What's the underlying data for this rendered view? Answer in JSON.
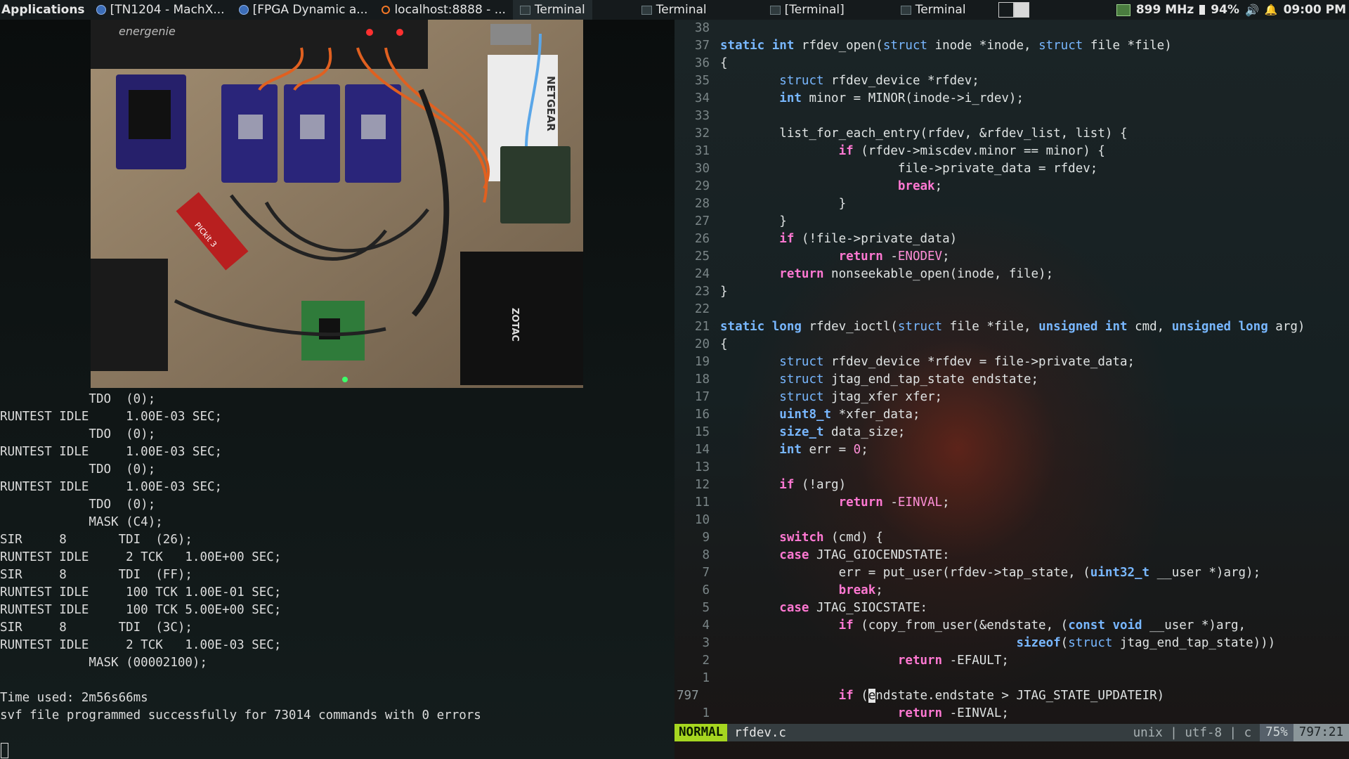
{
  "panel": {
    "applications": "Applications",
    "tasks": [
      {
        "label": "[TN1204 - MachX...",
        "icon": "browser-icon"
      },
      {
        "label": "[FPGA Dynamic a...",
        "icon": "browser-icon"
      },
      {
        "label": "localhost:8888 - ...",
        "icon": "jupyter-icon"
      },
      {
        "label": "Terminal",
        "icon": "terminal-icon"
      },
      {
        "label": "Terminal",
        "icon": "terminal-icon"
      },
      {
        "label": "[Terminal]",
        "icon": "terminal-icon"
      },
      {
        "label": "Terminal",
        "icon": "terminal-icon"
      }
    ],
    "cpu": "899 MHz",
    "battery": "94%",
    "clock": "09:00 PM"
  },
  "left_terminal": {
    "camera_feed_labels": [
      "energenie",
      "NETGEAR",
      "ZOTAC",
      "PICkit 3"
    ],
    "output": "            TDO  (0);\nRUNTEST IDLE     1.00E-03 SEC;\n            TDO  (0);\nRUNTEST IDLE     1.00E-03 SEC;\n            TDO  (0);\nRUNTEST IDLE     1.00E-03 SEC;\n            TDO  (0);\n            MASK (C4);\nSIR     8       TDI  (26);\nRUNTEST IDLE     2 TCK   1.00E+00 SEC;\nSIR     8       TDI  (FF);\nRUNTEST IDLE     100 TCK 1.00E-01 SEC;\nRUNTEST IDLE     100 TCK 5.00E+00 SEC;\nSIR     8       TDI  (3C);\nRUNTEST IDLE     2 TCK   1.00E-03 SEC;\n            MASK (00002100);\n\nTime used: 2m56s66ms\nsvf file programmed successfully for 73014 commands with 0 errors"
  },
  "editor": {
    "lines": [
      {
        "n": "38",
        "t": []
      },
      {
        "n": "37",
        "t": [
          [
            "keyword",
            "static"
          ],
          [
            "plain",
            " "
          ],
          [
            "keyword",
            "int"
          ],
          [
            "plain",
            " rfdev_open("
          ],
          [
            "type",
            "struct"
          ],
          [
            "plain",
            " inode *inode, "
          ],
          [
            "type",
            "struct"
          ],
          [
            "plain",
            " file *file)"
          ]
        ]
      },
      {
        "n": "36",
        "t": [
          [
            "plain",
            "{"
          ]
        ]
      },
      {
        "n": "35",
        "t": [
          [
            "plain",
            "        "
          ],
          [
            "type",
            "struct"
          ],
          [
            "plain",
            " rfdev_device *rfdev;"
          ]
        ]
      },
      {
        "n": "34",
        "t": [
          [
            "plain",
            "        "
          ],
          [
            "keyword",
            "int"
          ],
          [
            "plain",
            " minor = MINOR(inode->i_rdev);"
          ]
        ]
      },
      {
        "n": "33",
        "t": []
      },
      {
        "n": "32",
        "t": [
          [
            "plain",
            "        list_for_each_entry(rfdev, &rfdev_list, list) {"
          ]
        ]
      },
      {
        "n": "31",
        "t": [
          [
            "plain",
            "                "
          ],
          [
            "ctrl",
            "if"
          ],
          [
            "plain",
            " (rfdev->miscdev.minor == minor) {"
          ]
        ]
      },
      {
        "n": "30",
        "t": [
          [
            "plain",
            "                        file->private_data = rfdev;"
          ]
        ]
      },
      {
        "n": "29",
        "t": [
          [
            "plain",
            "                        "
          ],
          [
            "ctrl",
            "break"
          ],
          [
            "plain",
            ";"
          ]
        ]
      },
      {
        "n": "28",
        "t": [
          [
            "plain",
            "                }"
          ]
        ]
      },
      {
        "n": "27",
        "t": [
          [
            "plain",
            "        }"
          ]
        ]
      },
      {
        "n": "26",
        "t": [
          [
            "plain",
            "        "
          ],
          [
            "ctrl",
            "if"
          ],
          [
            "plain",
            " (!file->private_data)"
          ]
        ]
      },
      {
        "n": "25",
        "t": [
          [
            "plain",
            "                "
          ],
          [
            "ctrl",
            "return"
          ],
          [
            "plain",
            " -"
          ],
          [
            "const",
            "ENODEV"
          ],
          [
            "plain",
            ";"
          ]
        ]
      },
      {
        "n": "24",
        "t": [
          [
            "plain",
            "        "
          ],
          [
            "ctrl",
            "return"
          ],
          [
            "plain",
            " nonseekable_open(inode, file);"
          ]
        ]
      },
      {
        "n": "23",
        "t": [
          [
            "plain",
            "}"
          ]
        ]
      },
      {
        "n": "22",
        "t": []
      },
      {
        "n": "21",
        "t": [
          [
            "keyword",
            "static"
          ],
          [
            "plain",
            " "
          ],
          [
            "keyword",
            "long"
          ],
          [
            "plain",
            " rfdev_ioctl("
          ],
          [
            "type",
            "struct"
          ],
          [
            "plain",
            " file *file, "
          ],
          [
            "keyword",
            "unsigned"
          ],
          [
            "plain",
            " "
          ],
          [
            "keyword",
            "int"
          ],
          [
            "plain",
            " cmd, "
          ],
          [
            "keyword",
            "unsigned"
          ],
          [
            "plain",
            " "
          ],
          [
            "keyword",
            "long"
          ],
          [
            "plain",
            " arg)"
          ]
        ]
      },
      {
        "n": "20",
        "t": [
          [
            "plain",
            "{"
          ]
        ]
      },
      {
        "n": "19",
        "t": [
          [
            "plain",
            "        "
          ],
          [
            "type",
            "struct"
          ],
          [
            "plain",
            " rfdev_device *rfdev = file->private_data;"
          ]
        ]
      },
      {
        "n": "18",
        "t": [
          [
            "plain",
            "        "
          ],
          [
            "type",
            "struct"
          ],
          [
            "plain",
            " jtag_end_tap_state endstate;"
          ]
        ]
      },
      {
        "n": "17",
        "t": [
          [
            "plain",
            "        "
          ],
          [
            "type",
            "struct"
          ],
          [
            "plain",
            " jtag_xfer xfer;"
          ]
        ]
      },
      {
        "n": "16",
        "t": [
          [
            "plain",
            "        "
          ],
          [
            "keyword",
            "uint8_t"
          ],
          [
            "plain",
            " *xfer_data;"
          ]
        ]
      },
      {
        "n": "15",
        "t": [
          [
            "plain",
            "        "
          ],
          [
            "keyword",
            "size_t"
          ],
          [
            "plain",
            " data_size;"
          ]
        ]
      },
      {
        "n": "14",
        "t": [
          [
            "plain",
            "        "
          ],
          [
            "keyword",
            "int"
          ],
          [
            "plain",
            " err = "
          ],
          [
            "num",
            "0"
          ],
          [
            "plain",
            ";"
          ]
        ]
      },
      {
        "n": "13",
        "t": []
      },
      {
        "n": "12",
        "t": [
          [
            "plain",
            "        "
          ],
          [
            "ctrl",
            "if"
          ],
          [
            "plain",
            " (!arg)"
          ]
        ]
      },
      {
        "n": "11",
        "t": [
          [
            "plain",
            "                "
          ],
          [
            "ctrl",
            "return"
          ],
          [
            "plain",
            " -"
          ],
          [
            "const",
            "EINVAL"
          ],
          [
            "plain",
            ";"
          ]
        ]
      },
      {
        "n": "10",
        "t": []
      },
      {
        "n": "9",
        "t": [
          [
            "plain",
            "        "
          ],
          [
            "ctrl",
            "switch"
          ],
          [
            "plain",
            " (cmd) {"
          ]
        ]
      },
      {
        "n": "8",
        "t": [
          [
            "plain",
            "        "
          ],
          [
            "ctrl",
            "case"
          ],
          [
            "plain",
            " JTAG_GIOCENDSTATE:"
          ]
        ]
      },
      {
        "n": "7",
        "t": [
          [
            "plain",
            "                err = put_user(rfdev->tap_state, ("
          ],
          [
            "keyword",
            "uint32_t"
          ],
          [
            "plain",
            " __user *)arg);"
          ]
        ]
      },
      {
        "n": "6",
        "t": [
          [
            "plain",
            "                "
          ],
          [
            "ctrl",
            "break"
          ],
          [
            "plain",
            ";"
          ]
        ]
      },
      {
        "n": "5",
        "t": [
          [
            "plain",
            "        "
          ],
          [
            "ctrl",
            "case"
          ],
          [
            "plain",
            " JTAG_SIOCSTATE:"
          ]
        ]
      },
      {
        "n": "4",
        "t": [
          [
            "plain",
            "                "
          ],
          [
            "ctrl",
            "if"
          ],
          [
            "plain",
            " (copy_from_user(&endstate, ("
          ],
          [
            "keyword",
            "const"
          ],
          [
            "plain",
            " "
          ],
          [
            "keyword",
            "void"
          ],
          [
            "plain",
            " __user *)arg,"
          ]
        ]
      },
      {
        "n": "3",
        "t": [
          [
            "plain",
            "                                        "
          ],
          [
            "keyword",
            "sizeof"
          ],
          [
            "plain",
            "("
          ],
          [
            "type",
            "struct"
          ],
          [
            "plain",
            " jtag_end_tap_state)))"
          ]
        ]
      },
      {
        "n": "2",
        "t": [
          [
            "plain",
            "                        "
          ],
          [
            "ctrl",
            "return"
          ],
          [
            "plain",
            " -EFAULT;"
          ]
        ]
      },
      {
        "n": "1",
        "t": []
      },
      {
        "n": "797",
        "cur": true,
        "t": [
          [
            "plain",
            "                "
          ],
          [
            "ctrl",
            "if"
          ],
          [
            "plain",
            " ("
          ],
          [
            "cursor",
            "e"
          ],
          [
            "plain",
            "ndstate.endstate > JTAG_STATE_UPDATEIR)"
          ]
        ]
      },
      {
        "n": "1",
        "t": [
          [
            "plain",
            "                        "
          ],
          [
            "ctrl",
            "return"
          ],
          [
            "plain",
            " -EINVAL;"
          ]
        ]
      }
    ],
    "status": {
      "mode": "NORMAL",
      "filename": "rfdev.c",
      "info": "unix | utf-8 | c",
      "percent": "75%",
      "position": "797:21"
    }
  }
}
